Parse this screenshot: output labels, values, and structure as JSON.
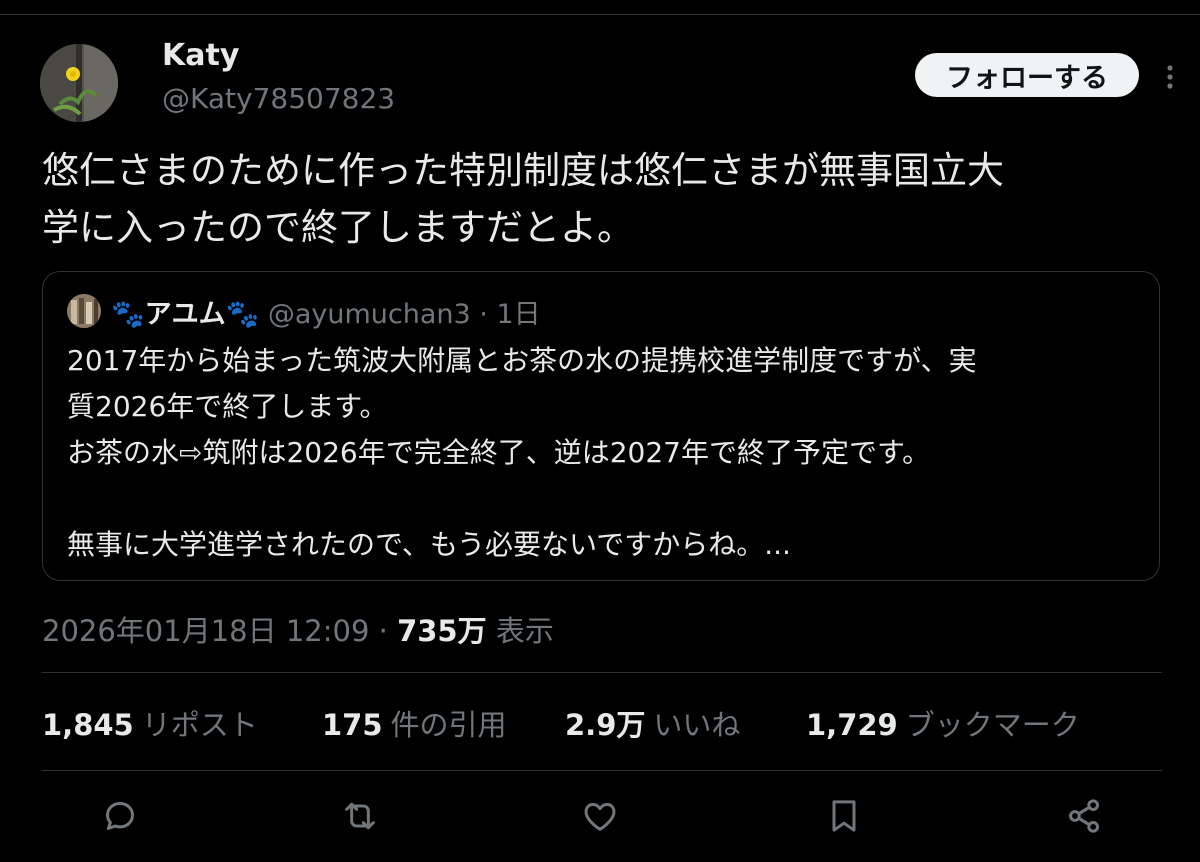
{
  "author": {
    "name": "Katy",
    "handle": "@Katy78507823"
  },
  "follow_label": "フォローする",
  "tweet_text": "悠仁さまのために作った特別制度は悠仁さまが無事国立大\n学に入ったので終了しますだとよ。",
  "quote": {
    "name": "🐾アユム🐾",
    "handle": "@ayumuchan3",
    "age": "· 1日",
    "text": "2017年から始まった筑波大附属とお茶の水の提携校進学制度ですが、実\n質2026年で終了します。\nお茶の水⇨筑附は2026年で完全終了、逆は2027年で終了予定です。\n\n無事に大学進学されたので、もう必要ないですからね。..."
  },
  "meta": {
    "timestamp": "2026年01月18日 12:09 · ",
    "views": "735万",
    "views_label": " 表示"
  },
  "stats": [
    {
      "num": "1,845",
      "label": "リポスト"
    },
    {
      "num": "175",
      "label": "件の引用"
    },
    {
      "num": "2.9万",
      "label": "いいね"
    },
    {
      "num": "1,729",
      "label": "ブックマーク"
    }
  ],
  "actions": [
    "reply-icon",
    "retweet-icon",
    "like-icon",
    "bookmark-icon",
    "share-icon"
  ],
  "colors": {
    "background": "#000000",
    "text_primary": "#e7e9ea",
    "text_secondary": "#71767b",
    "border": "#2f3336",
    "follow_bg": "#eff3f4"
  }
}
